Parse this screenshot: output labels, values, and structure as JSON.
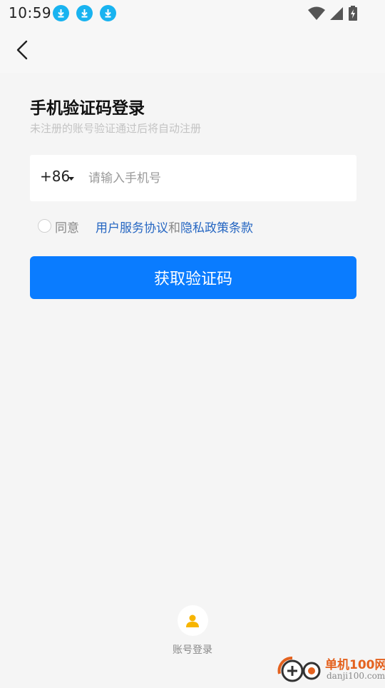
{
  "status_bar": {
    "time": "10:59",
    "download_icons": [
      "download-icon",
      "download-icon",
      "download-icon"
    ],
    "accent": "#18b3f0"
  },
  "header": {
    "back_icon": "chevron-left-icon"
  },
  "login": {
    "title": "手机验证码登录",
    "subtitle": "未注册的账号验证通过后将自动注册",
    "country_code": "+86",
    "phone_placeholder": "请输入手机号",
    "agree_label": "同意",
    "user_agreement": "用户服务协议",
    "and": "和",
    "privacy_policy": "隐私政策条款",
    "submit_label": "获取验证码",
    "submit_color": "#0a7cff"
  },
  "footer": {
    "account_login_icon": "person-icon",
    "account_login_label": "账号登录"
  },
  "watermark": {
    "title": "单机100网",
    "url": "danji100.com"
  }
}
